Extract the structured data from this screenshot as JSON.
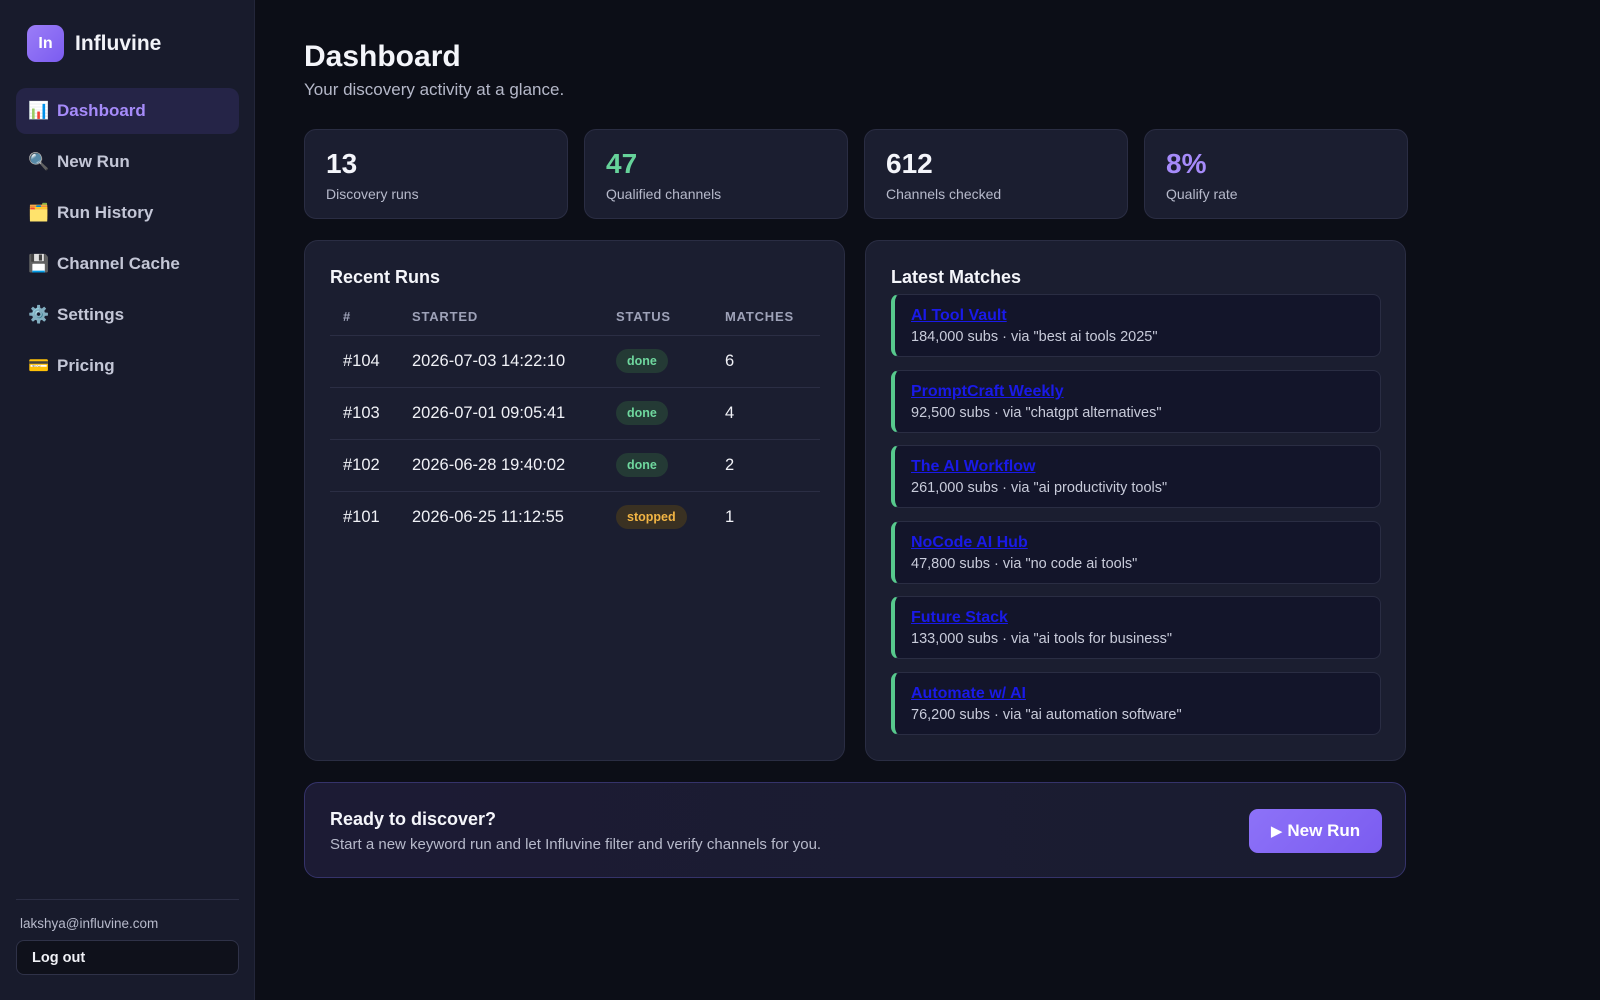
{
  "brand": {
    "logo_text": "In",
    "name": "Influvine",
    "accent": "#7b5cf0"
  },
  "sidebar": {
    "items": [
      {
        "icon": "bar-chart-icon",
        "glyph": "📊",
        "label": "Dashboard",
        "active": true
      },
      {
        "icon": "magnifier-icon",
        "glyph": "🔍",
        "label": "New Run"
      },
      {
        "icon": "folder-icon",
        "glyph": "🗂️",
        "label": "Run History"
      },
      {
        "icon": "floppy-disk-icon",
        "glyph": "💾",
        "label": "Channel Cache"
      },
      {
        "icon": "gear-icon",
        "glyph": "⚙️",
        "label": "Settings"
      },
      {
        "icon": "credit-card-icon",
        "glyph": "💳",
        "label": "Pricing"
      }
    ],
    "user_email": "lakshya@influvine.com",
    "logout_label": "Log out"
  },
  "header": {
    "title": "Dashboard",
    "subtitle": "Your discovery activity at a glance."
  },
  "stats": [
    {
      "value": "13",
      "label": "Discovery runs",
      "color": "#f4f5fa"
    },
    {
      "value": "47",
      "label": "Qualified channels",
      "color": "#66d39a"
    },
    {
      "value": "612",
      "label": "Channels checked",
      "color": "#f4f5fa"
    },
    {
      "value": "8%",
      "label": "Qualify rate",
      "color": "#a68bfa"
    }
  ],
  "recent_runs": {
    "title": "Recent Runs",
    "columns": [
      "#",
      "STARTED",
      "STATUS",
      "MATCHES"
    ],
    "rows": [
      {
        "num": "#104",
        "started": "2026-07-03 14:22:10",
        "status": "done",
        "matches": "6"
      },
      {
        "num": "#103",
        "started": "2026-07-01 09:05:41",
        "status": "done",
        "matches": "4"
      },
      {
        "num": "#102",
        "started": "2026-06-28 19:40:02",
        "status": "done",
        "matches": "2"
      },
      {
        "num": "#101",
        "started": "2026-06-25 11:12:55",
        "status": "stopped",
        "matches": "1"
      }
    ]
  },
  "latest_matches": {
    "title": "Latest Matches",
    "items": [
      {
        "name": "AI Tool Vault",
        "meta": "184,000 subs · via \"best ai tools 2025\""
      },
      {
        "name": "PromptCraft Weekly",
        "meta": "92,500 subs · via \"chatgpt alternatives\""
      },
      {
        "name": "The AI Workflow",
        "meta": "261,000 subs · via \"ai productivity tools\""
      },
      {
        "name": "NoCode AI Hub",
        "meta": "47,800 subs · via \"no code ai tools\""
      },
      {
        "name": "Future Stack",
        "meta": "133,000 subs · via \"ai tools for business\""
      },
      {
        "name": "Automate w/ AI",
        "meta": "76,200 subs · via \"ai automation software\""
      }
    ]
  },
  "cta": {
    "title": "Ready to discover?",
    "text": "Start a new keyword run and let Influvine filter and verify channels for you.",
    "button_icon": "play-icon",
    "button_glyph": "▶",
    "button_label": "New Run"
  }
}
